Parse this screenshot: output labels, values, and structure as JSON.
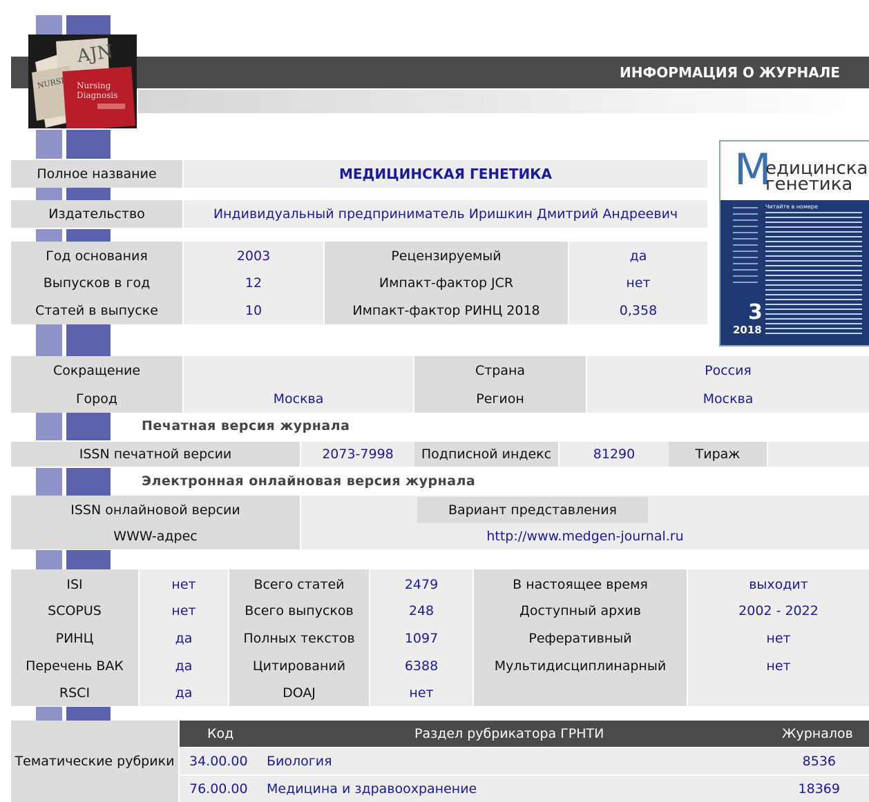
{
  "header": {
    "title": "ИНФОРМАЦИЯ О ЖУРНАЛЕ"
  },
  "logo_images": {
    "top_left": "journal-covers-photo",
    "cover": {
      "title_line1": "едицинская",
      "title_line2": "генетика",
      "initial": "М",
      "issue": "3",
      "year": "2018",
      "contents_label": "Читайте в номере"
    }
  },
  "main": {
    "full_name_label": "Полное название",
    "full_name": "МЕДИЦИНСКАЯ ГЕНЕТИКА",
    "publisher_label": "Издательство",
    "publisher": "Индивидуальный предприниматель Иришкин Дмитрий Андреевич",
    "founded_label": "Год основания",
    "founded": "2003",
    "issues_label": "Выпусков в год",
    "issues": "12",
    "articles_label": "Статей в выпуске",
    "articles": "10",
    "reviewed_label": "Рецензируемый",
    "reviewed": "да",
    "jcr_label": "Импакт-фактор JCR",
    "jcr": "нет",
    "rinc_if_label": "Импакт-фактор РИНЦ 2018",
    "rinc_if": "0,358"
  },
  "location": {
    "abbrev_label": "Сокращение",
    "abbrev": "",
    "country_label": "Страна",
    "country": "Россия",
    "city_label": "Город",
    "city": "Москва",
    "region_label": "Регион",
    "region": "Москва"
  },
  "print": {
    "section_title": "Печатная версия журнала",
    "issn_label": "ISSN печатной версии",
    "issn": "2073-7998",
    "index_label": "Подписной индекс",
    "index": "81290",
    "circulation_label": "Тираж",
    "circulation": ""
  },
  "online": {
    "section_title": "Электронная онлайновая версия журнала",
    "issn_label": "ISSN онлайновой версии",
    "issn": "",
    "variant_label": "Вариант представления",
    "variant": "",
    "www_label": "WWW-адрес",
    "www": "http://www.medgen-journal.ru"
  },
  "indexing": {
    "isi_label": "ISI",
    "isi": "нет",
    "scopus_label": "SCOPUS",
    "scopus": "нет",
    "rinc_label": "РИНЦ",
    "rinc": "да",
    "vak_label": "Перечень ВАК",
    "vak": "да",
    "rsci_label": "RSCI",
    "rsci": "да",
    "total_articles_label": "Всего статей",
    "total_articles": "2479",
    "total_issues_label": "Всего выпусков",
    "total_issues": "248",
    "full_texts_label": "Полных текстов",
    "full_texts": "1097",
    "citations_label": "Цитирований",
    "citations": "6388",
    "doaj_label": "DOAJ",
    "doaj": "нет",
    "current_label": "В настоящее время",
    "current": "выходит",
    "archive_label": "Доступный архив",
    "archive": "2002 - 2022",
    "abstract_label": "Реферативный",
    "abstract": "нет",
    "multi_label": "Мультидисциплинарный",
    "multi": "нет"
  },
  "rubrics": {
    "label": "Тематические рубрики",
    "headers": {
      "code": "Код",
      "section": "Раздел рубрикатора ГРНТИ",
      "journals": "Журналов"
    },
    "rows": [
      {
        "code": "34.00.00",
        "name": "Биология",
        "count": "8536"
      },
      {
        "code": "76.00.00",
        "name": "Медицина и здравоохранение",
        "count": "18369"
      }
    ]
  },
  "colors": {
    "header_bar": "#4a4a4a",
    "label_bg": "#dcdcdc",
    "value_text": "#1a1a9c",
    "square_light": "#9093c9",
    "square_dark": "#5b62ad"
  }
}
